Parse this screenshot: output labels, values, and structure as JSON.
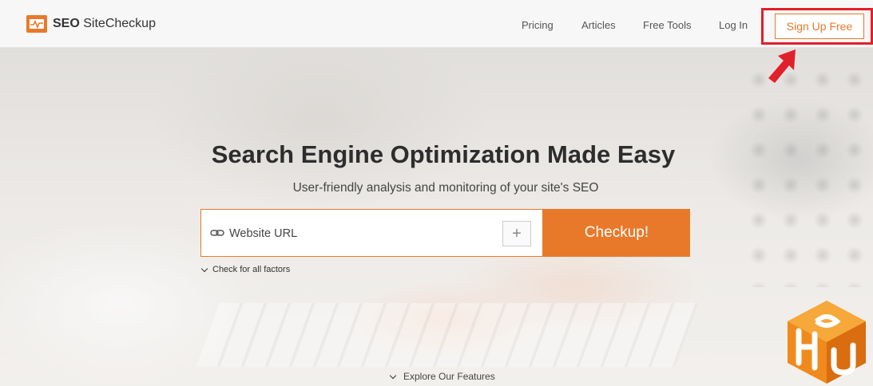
{
  "logo": {
    "brand_bold": "SEO",
    "brand_rest": "SiteCheckup",
    "icon": "pulse-icon"
  },
  "nav": {
    "items": [
      {
        "label": "Pricing"
      },
      {
        "label": "Articles"
      },
      {
        "label": "Free Tools"
      },
      {
        "label": "Log In"
      }
    ],
    "signup_label": "Sign Up Free"
  },
  "hero": {
    "headline": "Search Engine Optimization Made Easy",
    "subheadline": "User-friendly analysis and monitoring of your site's SEO"
  },
  "search": {
    "placeholder": "Website URL",
    "value": "",
    "plus_label": "+",
    "submit_label": "Checkup!",
    "options_toggle": "Check for all factors"
  },
  "explore_label": "Explore Our Features",
  "colors": {
    "accent": "#e9792a",
    "highlight": "#e0202a"
  }
}
